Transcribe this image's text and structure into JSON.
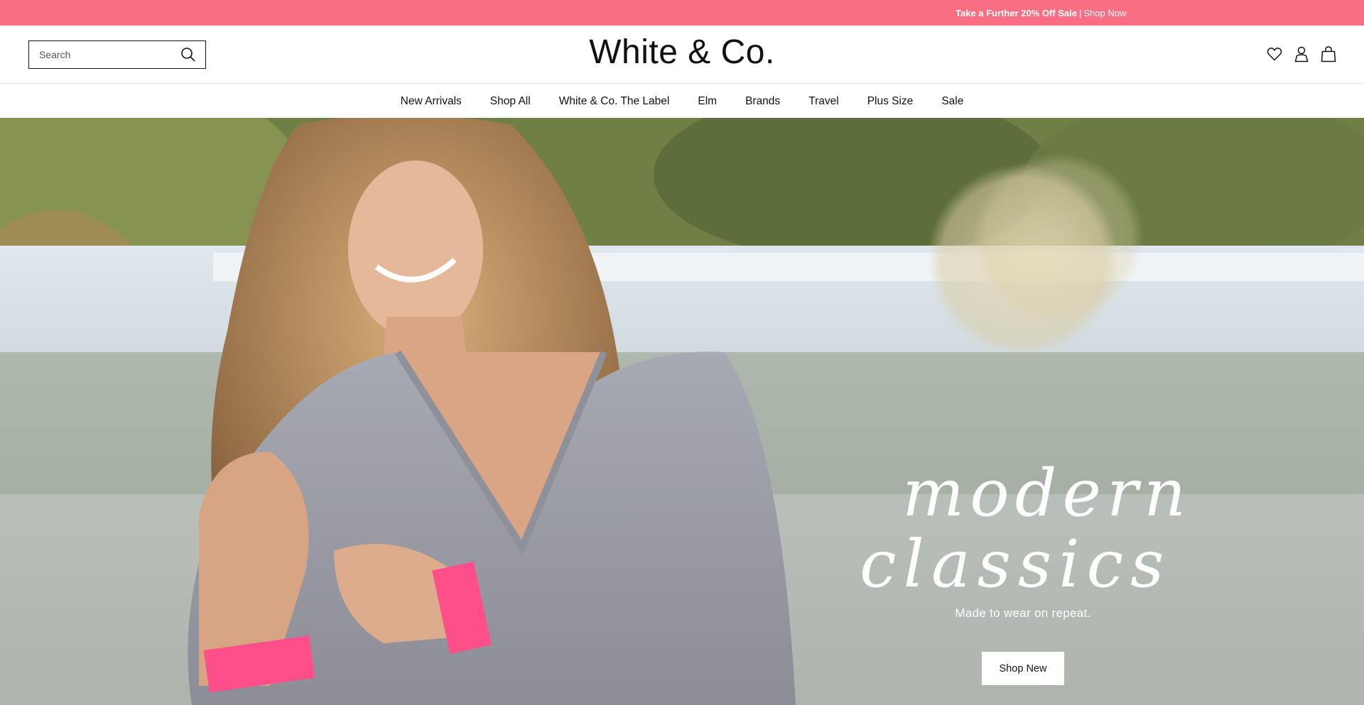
{
  "promo": {
    "bold_text": "Take a Further 20% Off Sale",
    "separator": "|",
    "link_text": "Shop Now"
  },
  "header": {
    "search_placeholder": "Search",
    "logo": "White & Co.",
    "icons": [
      "heart-icon",
      "account-icon",
      "bag-icon"
    ]
  },
  "nav": {
    "items": [
      "New Arrivals",
      "Shop All",
      "White & Co. The Label",
      "Elm",
      "Brands",
      "Travel",
      "Plus Size",
      "Sale"
    ]
  },
  "hero": {
    "title_line1": "modern",
    "title_line2": "classics",
    "subtitle": "Made to wear on repeat.",
    "cta": "Shop New"
  },
  "colors": {
    "promo_bg": "#f76f80",
    "text": "#111111",
    "accent_pink": "#ff4f8a"
  }
}
